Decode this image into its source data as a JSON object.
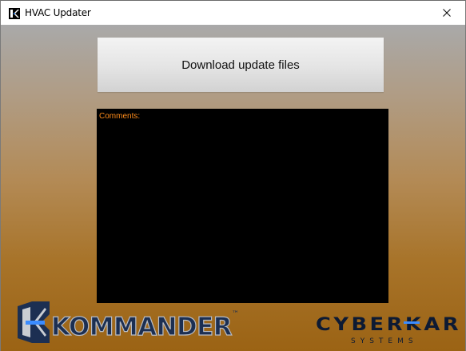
{
  "window": {
    "title": "HVAC Updater",
    "icon": "kommander-app-icon",
    "close_glyph": "✕"
  },
  "main": {
    "download_button_label": "Download update files",
    "comments_label": "Comments:",
    "comments_value": ""
  },
  "branding": {
    "left_logo_text": "KOMMANDER",
    "left_logo_tm": "™",
    "right_logo_text": "CYBERKAR",
    "right_logo_subtext": "SYSTEMS"
  },
  "colors": {
    "comments_label": "#ff8c1a",
    "logo_dark": "#1c2f52",
    "logo_accent": "#3b8cff"
  }
}
